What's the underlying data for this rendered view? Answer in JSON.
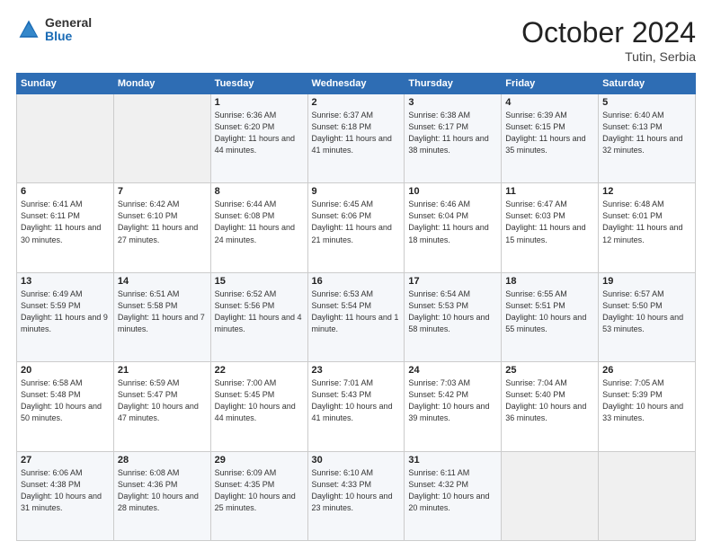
{
  "header": {
    "logo_general": "General",
    "logo_blue": "Blue",
    "month": "October 2024",
    "location": "Tutin, Serbia"
  },
  "days_of_week": [
    "Sunday",
    "Monday",
    "Tuesday",
    "Wednesday",
    "Thursday",
    "Friday",
    "Saturday"
  ],
  "weeks": [
    [
      {
        "day": "",
        "sunrise": "",
        "sunset": "",
        "daylight": ""
      },
      {
        "day": "",
        "sunrise": "",
        "sunset": "",
        "daylight": ""
      },
      {
        "day": "1",
        "sunrise": "Sunrise: 6:36 AM",
        "sunset": "Sunset: 6:20 PM",
        "daylight": "Daylight: 11 hours and 44 minutes."
      },
      {
        "day": "2",
        "sunrise": "Sunrise: 6:37 AM",
        "sunset": "Sunset: 6:18 PM",
        "daylight": "Daylight: 11 hours and 41 minutes."
      },
      {
        "day": "3",
        "sunrise": "Sunrise: 6:38 AM",
        "sunset": "Sunset: 6:17 PM",
        "daylight": "Daylight: 11 hours and 38 minutes."
      },
      {
        "day": "4",
        "sunrise": "Sunrise: 6:39 AM",
        "sunset": "Sunset: 6:15 PM",
        "daylight": "Daylight: 11 hours and 35 minutes."
      },
      {
        "day": "5",
        "sunrise": "Sunrise: 6:40 AM",
        "sunset": "Sunset: 6:13 PM",
        "daylight": "Daylight: 11 hours and 32 minutes."
      }
    ],
    [
      {
        "day": "6",
        "sunrise": "Sunrise: 6:41 AM",
        "sunset": "Sunset: 6:11 PM",
        "daylight": "Daylight: 11 hours and 30 minutes."
      },
      {
        "day": "7",
        "sunrise": "Sunrise: 6:42 AM",
        "sunset": "Sunset: 6:10 PM",
        "daylight": "Daylight: 11 hours and 27 minutes."
      },
      {
        "day": "8",
        "sunrise": "Sunrise: 6:44 AM",
        "sunset": "Sunset: 6:08 PM",
        "daylight": "Daylight: 11 hours and 24 minutes."
      },
      {
        "day": "9",
        "sunrise": "Sunrise: 6:45 AM",
        "sunset": "Sunset: 6:06 PM",
        "daylight": "Daylight: 11 hours and 21 minutes."
      },
      {
        "day": "10",
        "sunrise": "Sunrise: 6:46 AM",
        "sunset": "Sunset: 6:04 PM",
        "daylight": "Daylight: 11 hours and 18 minutes."
      },
      {
        "day": "11",
        "sunrise": "Sunrise: 6:47 AM",
        "sunset": "Sunset: 6:03 PM",
        "daylight": "Daylight: 11 hours and 15 minutes."
      },
      {
        "day": "12",
        "sunrise": "Sunrise: 6:48 AM",
        "sunset": "Sunset: 6:01 PM",
        "daylight": "Daylight: 11 hours and 12 minutes."
      }
    ],
    [
      {
        "day": "13",
        "sunrise": "Sunrise: 6:49 AM",
        "sunset": "Sunset: 5:59 PM",
        "daylight": "Daylight: 11 hours and 9 minutes."
      },
      {
        "day": "14",
        "sunrise": "Sunrise: 6:51 AM",
        "sunset": "Sunset: 5:58 PM",
        "daylight": "Daylight: 11 hours and 7 minutes."
      },
      {
        "day": "15",
        "sunrise": "Sunrise: 6:52 AM",
        "sunset": "Sunset: 5:56 PM",
        "daylight": "Daylight: 11 hours and 4 minutes."
      },
      {
        "day": "16",
        "sunrise": "Sunrise: 6:53 AM",
        "sunset": "Sunset: 5:54 PM",
        "daylight": "Daylight: 11 hours and 1 minute."
      },
      {
        "day": "17",
        "sunrise": "Sunrise: 6:54 AM",
        "sunset": "Sunset: 5:53 PM",
        "daylight": "Daylight: 10 hours and 58 minutes."
      },
      {
        "day": "18",
        "sunrise": "Sunrise: 6:55 AM",
        "sunset": "Sunset: 5:51 PM",
        "daylight": "Daylight: 10 hours and 55 minutes."
      },
      {
        "day": "19",
        "sunrise": "Sunrise: 6:57 AM",
        "sunset": "Sunset: 5:50 PM",
        "daylight": "Daylight: 10 hours and 53 minutes."
      }
    ],
    [
      {
        "day": "20",
        "sunrise": "Sunrise: 6:58 AM",
        "sunset": "Sunset: 5:48 PM",
        "daylight": "Daylight: 10 hours and 50 minutes."
      },
      {
        "day": "21",
        "sunrise": "Sunrise: 6:59 AM",
        "sunset": "Sunset: 5:47 PM",
        "daylight": "Daylight: 10 hours and 47 minutes."
      },
      {
        "day": "22",
        "sunrise": "Sunrise: 7:00 AM",
        "sunset": "Sunset: 5:45 PM",
        "daylight": "Daylight: 10 hours and 44 minutes."
      },
      {
        "day": "23",
        "sunrise": "Sunrise: 7:01 AM",
        "sunset": "Sunset: 5:43 PM",
        "daylight": "Daylight: 10 hours and 41 minutes."
      },
      {
        "day": "24",
        "sunrise": "Sunrise: 7:03 AM",
        "sunset": "Sunset: 5:42 PM",
        "daylight": "Daylight: 10 hours and 39 minutes."
      },
      {
        "day": "25",
        "sunrise": "Sunrise: 7:04 AM",
        "sunset": "Sunset: 5:40 PM",
        "daylight": "Daylight: 10 hours and 36 minutes."
      },
      {
        "day": "26",
        "sunrise": "Sunrise: 7:05 AM",
        "sunset": "Sunset: 5:39 PM",
        "daylight": "Daylight: 10 hours and 33 minutes."
      }
    ],
    [
      {
        "day": "27",
        "sunrise": "Sunrise: 6:06 AM",
        "sunset": "Sunset: 4:38 PM",
        "daylight": "Daylight: 10 hours and 31 minutes."
      },
      {
        "day": "28",
        "sunrise": "Sunrise: 6:08 AM",
        "sunset": "Sunset: 4:36 PM",
        "daylight": "Daylight: 10 hours and 28 minutes."
      },
      {
        "day": "29",
        "sunrise": "Sunrise: 6:09 AM",
        "sunset": "Sunset: 4:35 PM",
        "daylight": "Daylight: 10 hours and 25 minutes."
      },
      {
        "day": "30",
        "sunrise": "Sunrise: 6:10 AM",
        "sunset": "Sunset: 4:33 PM",
        "daylight": "Daylight: 10 hours and 23 minutes."
      },
      {
        "day": "31",
        "sunrise": "Sunrise: 6:11 AM",
        "sunset": "Sunset: 4:32 PM",
        "daylight": "Daylight: 10 hours and 20 minutes."
      },
      {
        "day": "",
        "sunrise": "",
        "sunset": "",
        "daylight": ""
      },
      {
        "day": "",
        "sunrise": "",
        "sunset": "",
        "daylight": ""
      }
    ]
  ]
}
